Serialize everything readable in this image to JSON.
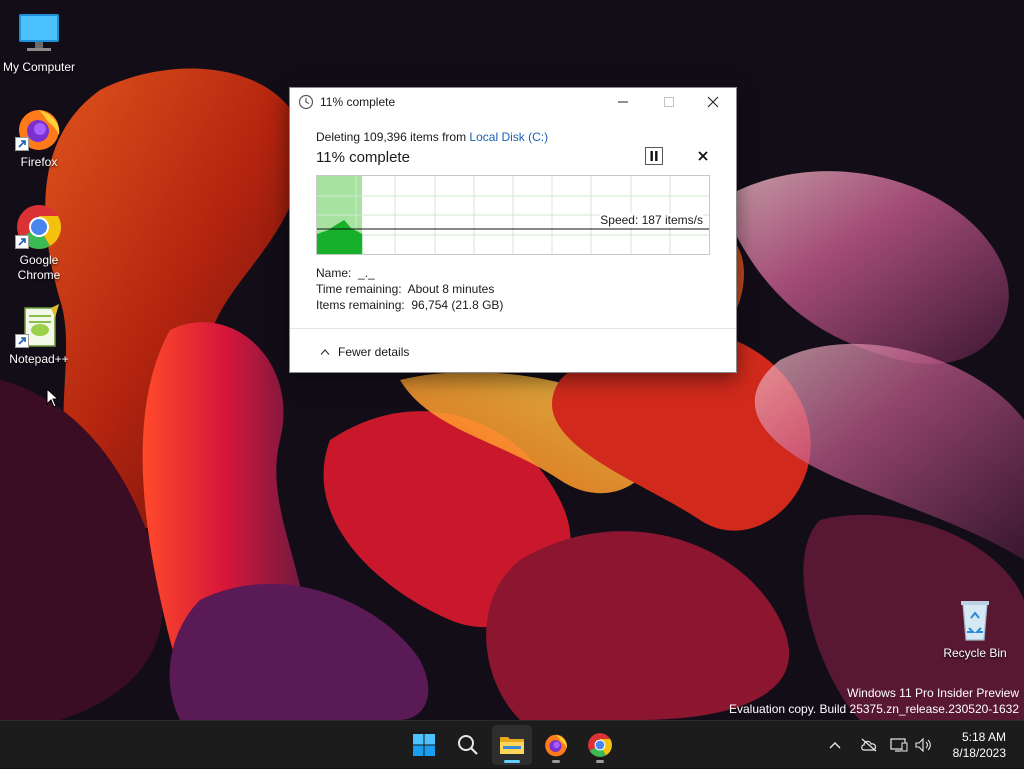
{
  "desktop": {
    "icons": [
      {
        "label": "My Computer",
        "icon": "computer-icon"
      },
      {
        "label": "Firefox",
        "icon": "firefox-icon"
      },
      {
        "label": "Google Chrome",
        "icon": "chrome-icon"
      },
      {
        "label": "Notepad++",
        "icon": "notepad-plus-plus-icon"
      },
      {
        "label": "Recycle Bin",
        "icon": "recycle-bin-icon"
      }
    ],
    "watermark_line1": "Windows 11 Pro Insider Preview",
    "watermark_line2": "Evaluation copy. Build 25375.zn_release.230520-1632"
  },
  "dialog": {
    "title": "11% complete",
    "deleting_prefix": "Deleting 109,396 items from ",
    "deleting_location": "Local Disk (C:)",
    "progress_heading": "11% complete",
    "progress_percent": 11,
    "speed": "Speed: 187 items/s",
    "name_label": "Name:",
    "name_value": "_._",
    "time_label": "Time remaining:",
    "time_value": "About 8 minutes",
    "items_label": "Items remaining:",
    "items_value": "96,754 (21.8 GB)",
    "fewer_details": "Fewer details",
    "colors": {
      "progress_fill": "#a6e3a1",
      "speed_fill": "#17b02a",
      "link": "#1a5fb4"
    }
  },
  "taskbar": {
    "apps": [
      "start-icon",
      "search-icon",
      "file-explorer-icon",
      "firefox-icon",
      "chrome-icon"
    ],
    "clock_time": "5:18 AM",
    "clock_date": "8/18/2023"
  }
}
